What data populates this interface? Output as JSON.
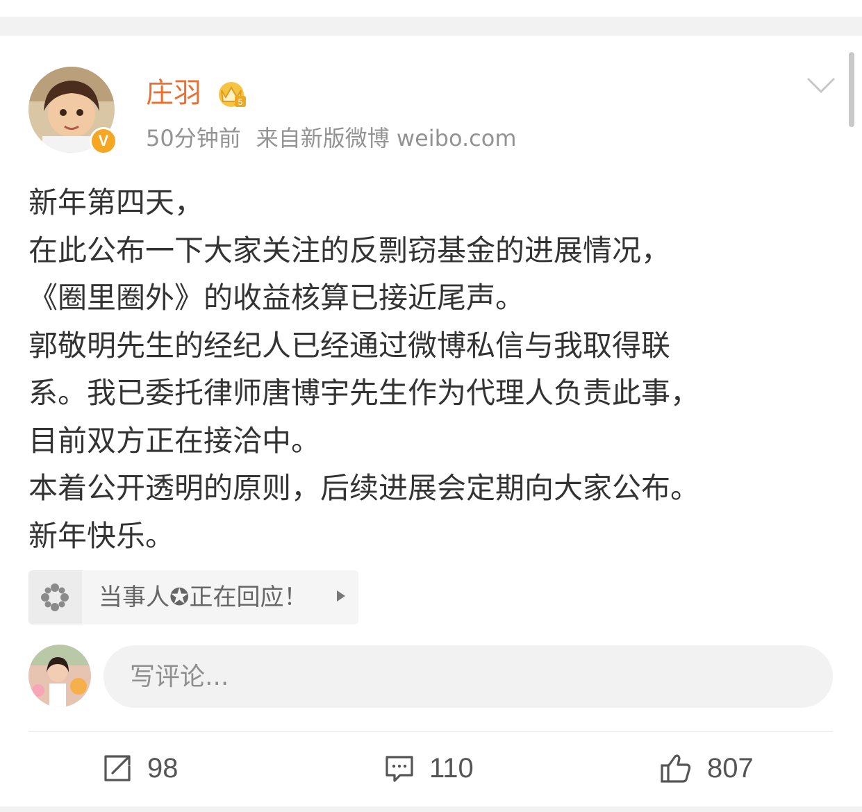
{
  "post": {
    "author": {
      "name": "庄羽",
      "verified_icon": "verified-v-badge",
      "member_icon": "crown-icon"
    },
    "time": "50分钟前",
    "source": "来自新版微博 weibo.com",
    "lines": [
      "新年第四天，",
      "在此公布一下大家关注的反剽窃基金的进展情况，",
      "《圈里圈外》的收益核算已接近尾声。",
      "郭敬明先生的经纪人已经通过微博私信与我取得联",
      "系。我已委托律师唐博宇先生作为代理人负责此事，",
      "目前双方正在接洽中。",
      "本着公开透明的原则，后续进展会定期向大家公布。",
      "新年快乐。"
    ]
  },
  "topic_card": {
    "text": "当事人✪正在回应！",
    "icon": "pinwheel-icon"
  },
  "comment_box": {
    "placeholder": "写评论..."
  },
  "actions": {
    "repost": {
      "count": "98",
      "icon": "repost-icon"
    },
    "comment": {
      "count": "110",
      "icon": "comment-icon"
    },
    "like": {
      "count": "807",
      "icon": "thumbs-up-icon"
    }
  },
  "colors": {
    "username": "#ec6f2d",
    "verified": "#f5a623",
    "text": "#333333",
    "meta": "#939393"
  }
}
